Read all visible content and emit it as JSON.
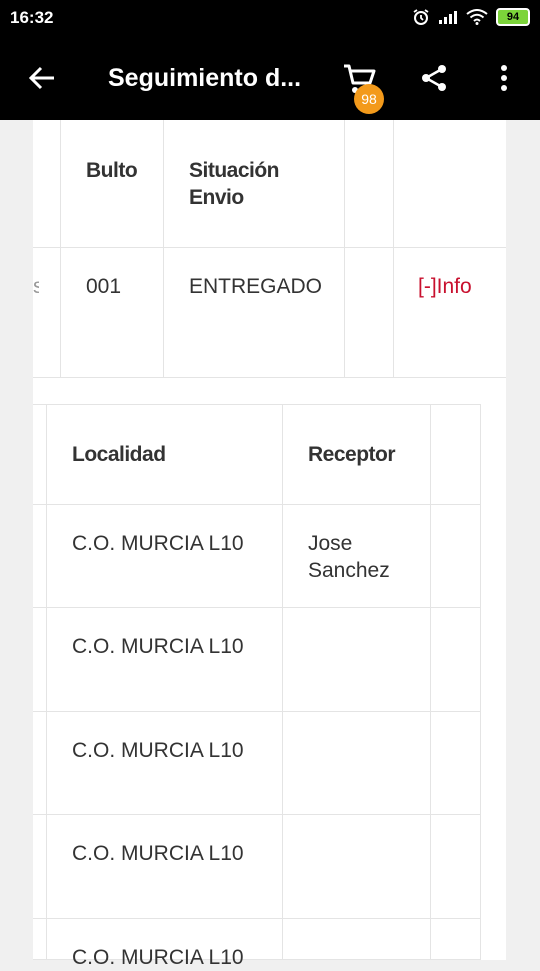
{
  "status_bar": {
    "time": "16:32",
    "battery": "94",
    "icons": [
      "alarm-icon",
      "signal-icon",
      "wifi-icon",
      "battery-icon"
    ]
  },
  "app_bar": {
    "title": "Seguimiento d...",
    "cart_count": "98",
    "icons": [
      "back-arrow-icon",
      "cart-icon",
      "share-icon",
      "more-vert-icon"
    ]
  },
  "shipment_table": {
    "headers": [
      "Bulto",
      "Situación Envio"
    ],
    "row": {
      "bulto": "001",
      "situacion": "ENTREGADO",
      "info_link": "[-]Info"
    }
  },
  "tracking_table": {
    "headers": [
      "Localidad",
      "Receptor"
    ],
    "rows": [
      {
        "localidad": "C.O. MURCIA L10",
        "receptor": "Jose Sanchez"
      },
      {
        "localidad": "C.O. MURCIA L10",
        "receptor": ""
      },
      {
        "localidad": "C.O. MURCIA L10",
        "receptor": ""
      },
      {
        "localidad": "C.O. MURCIA L10",
        "receptor": ""
      },
      {
        "localidad": "C.O. MURCIA L10",
        "receptor": ""
      }
    ]
  },
  "colors": {
    "app_bar": "#000000",
    "badge": "#f39a1b",
    "info_link": "#c8102e",
    "battery": "#7cd43a"
  }
}
